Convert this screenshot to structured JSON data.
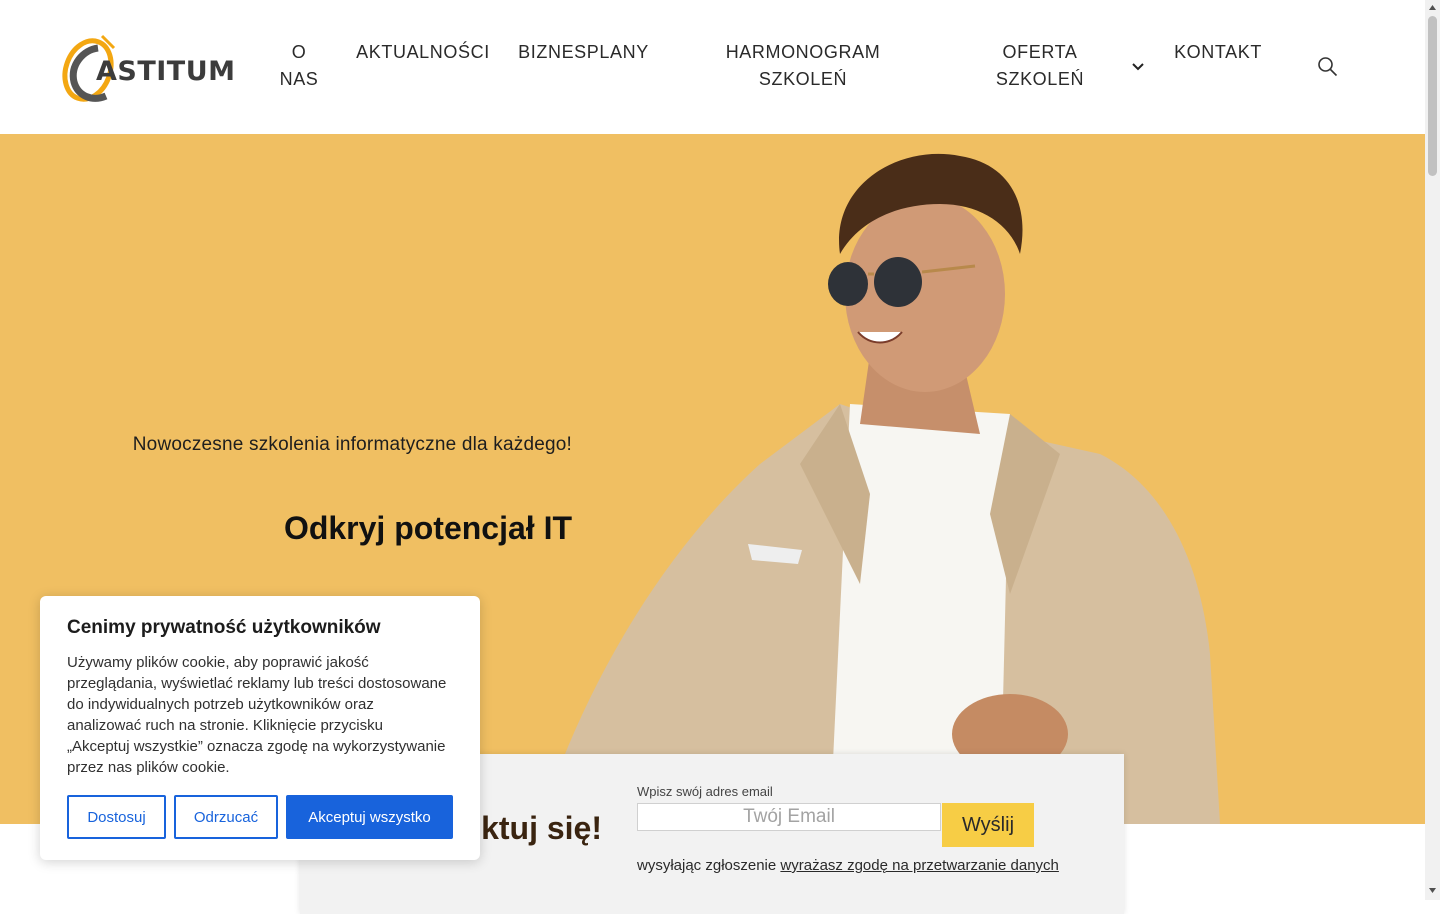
{
  "header": {
    "logo_text": "ASTITUM",
    "nav": {
      "o_nas": "O NAS",
      "aktualnosci": "AKTUALNOŚCI",
      "biznesplany": "BIZNESPLANY",
      "harmonogram": "HARMONOGRAM SZKOLEŃ",
      "oferta": "OFERTA SZKOLEŃ",
      "kontakt": "KONTAKT"
    },
    "dropdown_icon": "chevron-down-icon",
    "search_icon": "search-icon"
  },
  "hero": {
    "subtitle": "Nowoczesne szkolenia informatyczne dla każdego!",
    "headline": "Odkryj potencjał IT",
    "background_color": "#f0bf62"
  },
  "newsletter": {
    "title": "ktuj się!",
    "email_label": "Wpisz swój adres email",
    "email_placeholder": "Twój Email",
    "submit_label": "Wyślij",
    "consent_prefix": "wysyłając zgłoszenie",
    "consent_link": "wyrażasz zgodę na przetwarzanie danych"
  },
  "cookie_banner": {
    "title": "Cenimy prywatność użytkowników",
    "text": "Używamy plików cookie, aby poprawić jakość przeglądania, wyświetlać reklamy lub treści dostosowane do indywidualnych potrzeb użytkowników oraz analizować ruch na stronie. Kliknięcie przycisku „Akceptuj wszystkie” oznacza zgodę na wykorzystywanie przez nas plików cookie.",
    "customize_label": "Dostosuj",
    "reject_label": "Odrzucać",
    "accept_label": "Akceptuj wszystko",
    "accent_color": "#1863dc"
  }
}
